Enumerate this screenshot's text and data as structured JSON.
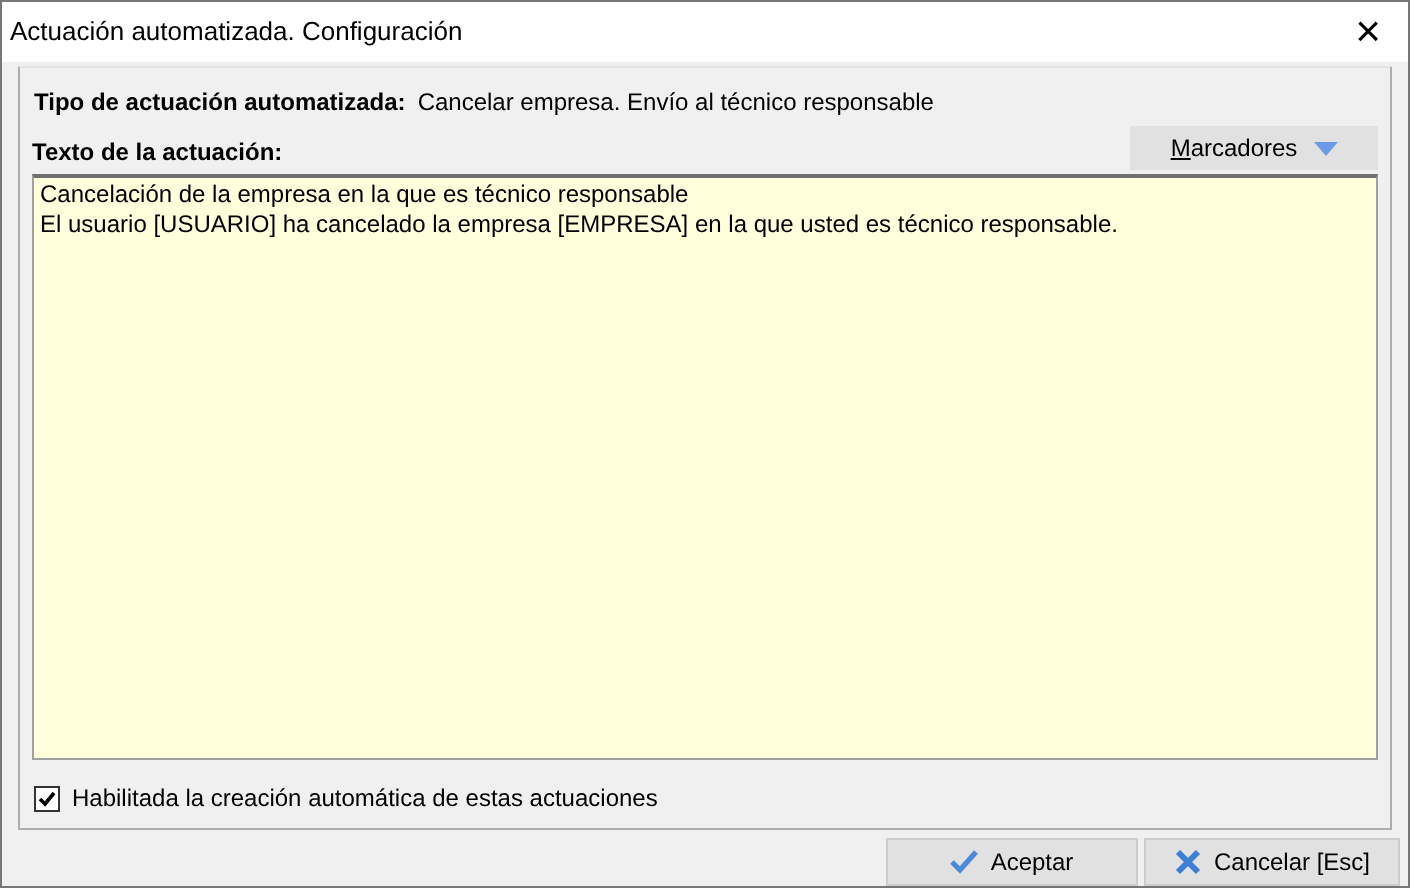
{
  "window": {
    "title": "Actuación automatizada. Configuración",
    "close": "×"
  },
  "type_row": {
    "label": "Tipo de actuación automatizada:",
    "value": "Cancelar empresa. Envío al técnico responsable"
  },
  "text_label": "Texto de la actuación:",
  "markers_button": {
    "label": "Marcadores"
  },
  "text_lines": [
    "Cancelación de la empresa en la que es técnico responsable",
    "El usuario [USUARIO] ha cancelado la empresa [EMPRESA] en la que usted es técnico responsable."
  ],
  "enable_checkbox": {
    "label": "Habilitada la creación automática de estas actuaciones",
    "checked": true
  },
  "buttons": [
    {
      "kind": "accept",
      "label": "Aceptar"
    },
    {
      "kind": "cancel",
      "label": "Cancelar [Esc]"
    }
  ]
}
